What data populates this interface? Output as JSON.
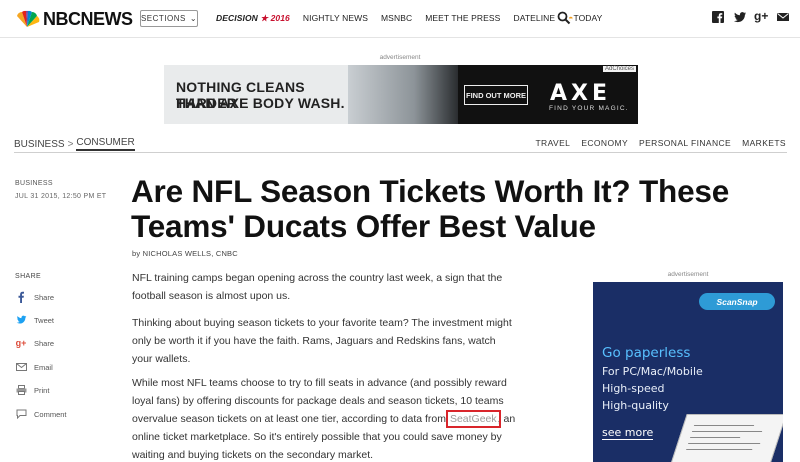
{
  "header": {
    "logo_text": "NBCNEWS",
    "sections_label": "SECTIONS",
    "nav": {
      "decision": "DECISION",
      "decision_year": "2016",
      "items": [
        "NIGHTLY NEWS",
        "MSNBC",
        "MEET THE PRESS",
        "DATELINE",
        "TODAY"
      ]
    },
    "icons": [
      "search-icon",
      "facebook-icon",
      "twitter-icon",
      "google-plus-icon",
      "email-icon"
    ]
  },
  "top_ad": {
    "label": "advertisement",
    "line1": "NOTHING CLEANS HARDER",
    "line2": "THAN AXE BODY WASH.",
    "cta": "FIND OUT MORE",
    "brand": "AXE",
    "tagline": "FIND YOUR MAGIC.",
    "choices": "AdChoices"
  },
  "breadcrumb": {
    "parent": "BUSINESS",
    "separator": ">",
    "current": "CONSUMER"
  },
  "subnav": [
    "TRAVEL",
    "ECONOMY",
    "PERSONAL FINANCE",
    "MARKETS"
  ],
  "meta": {
    "category": "BUSINESS",
    "date": "JUL 31 2015, 12:50 PM ET"
  },
  "share": {
    "label": "SHARE",
    "items": [
      {
        "label": "Share",
        "icon": "facebook-icon"
      },
      {
        "label": "Tweet",
        "icon": "twitter-icon"
      },
      {
        "label": "Share",
        "icon": "google-plus-icon"
      },
      {
        "label": "Email",
        "icon": "email-icon"
      },
      {
        "label": "Print",
        "icon": "print-icon"
      },
      {
        "label": "Comment",
        "icon": "comment-icon"
      }
    ]
  },
  "article": {
    "headline_line1": "Are NFL Season Tickets Worth It? These",
    "headline_line2": "Teams' Ducats Offer Best Value",
    "byline": "by NICHOLAS WELLS, CNBC",
    "p1": "NFL training camps began opening across the country last week, a sign that the football season is almost upon us.",
    "p2": "Thinking about buying season tickets to your favorite team? The investment might only be worth it if you have the faith. Rams, Jaguars and Redskins fans, watch your wallets.",
    "p3_before": "While most NFL teams choose to try to fill seats in advance (and possibly reward loyal fans) by offering discounts for package deals and season tickets, 10 teams overvalue season tickets on at least one tier, according to data from ",
    "p3_link": "SeatGeek",
    "p3_after": ", an online ticket marketplace. So it's entirely possible that you could save money by waiting and buying tickets on the secondary market."
  },
  "side_ad": {
    "label": "advertisement",
    "brand": "ScanSnap",
    "t1": "Go paperless",
    "t2": "For PC/Mac/Mobile",
    "t3": "High-speed",
    "t4": "High-quality",
    "more": "see more"
  },
  "colors": {
    "accent_red": "#d9252b",
    "ad_blue": "#1a2e66",
    "ad_cyan": "#58c0ff"
  }
}
